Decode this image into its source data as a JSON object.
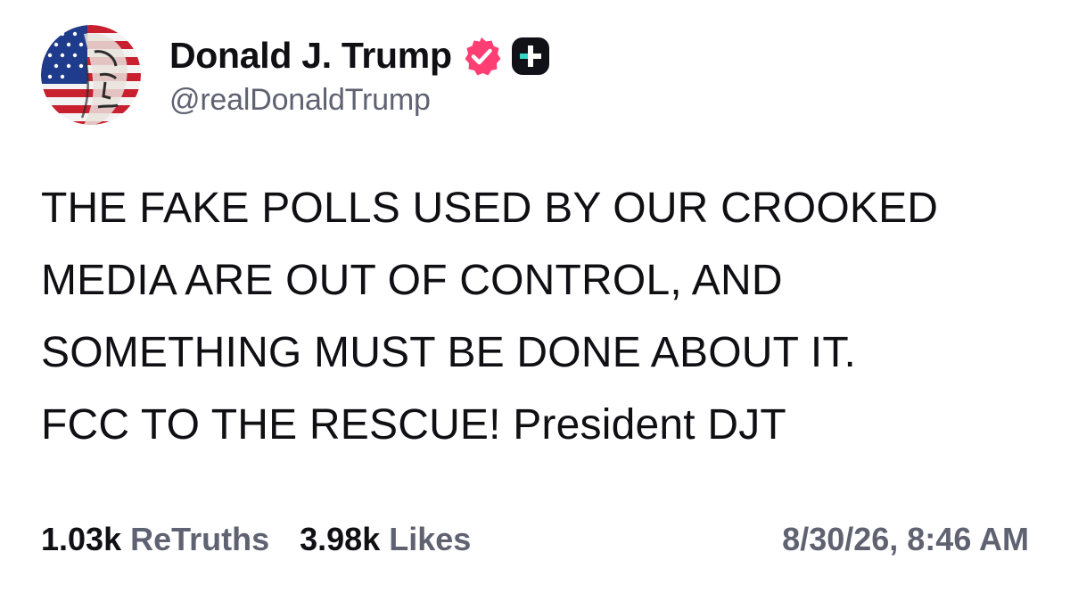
{
  "author": {
    "display_name": "Donald J. Trump",
    "handle": "@realDonaldTrump",
    "avatar_icon": "flag-portrait-avatar",
    "verified_icon": "verified-badge-icon",
    "plus_icon": "truth-plus-icon"
  },
  "post": {
    "lines": [
      "THE FAKE POLLS USED BY OUR CROOKED",
      "MEDIA ARE OUT OF CONTROL, AND",
      "SOMETHING MUST BE DONE ABOUT IT.",
      "FCC TO THE RESCUE! President DJT"
    ]
  },
  "stats": {
    "retruths_count": "1.03k",
    "retruths_label": "ReTruths",
    "likes_count": "3.98k",
    "likes_label": "Likes",
    "timestamp": "8/30/26, 8:46 AM"
  },
  "colors": {
    "text_primary": "#0f0f14",
    "text_secondary": "#5f6271",
    "verified_badge": "#ff3e73",
    "plus_badge": "#111118",
    "plus_accent": "#35d7c6",
    "flag_red": "#c8202f",
    "flag_blue": "#1f3c8c"
  }
}
